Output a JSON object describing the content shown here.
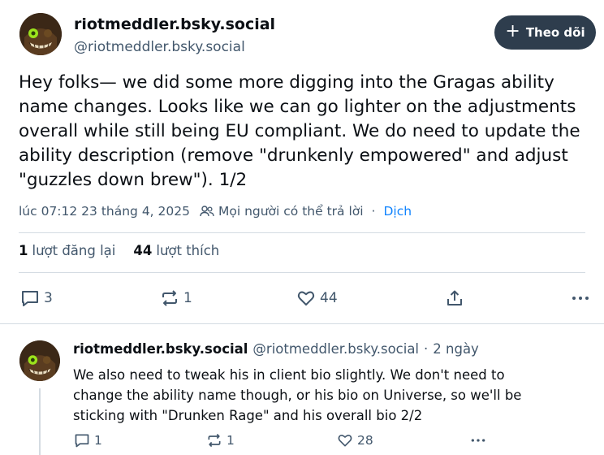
{
  "main_post": {
    "display_name": "riotmeddler.bsky.social",
    "handle": "@riotmeddler.bsky.social",
    "follow_label": "Theo dõi",
    "text": "Hey folks— we did some more digging into the Gragas ability\nname changes. Looks like we can go lighter on the adjustments\noverall while still being EU compliant. We do need to update the\nability description (remove \"drunkenly empowered\" and adjust\n\"guzzles down brew\"). 1/2",
    "timestamp": "lúc 07:12 23 tháng 4, 2025",
    "reply_setting": "Mọi người có thể trả lời",
    "separator": "·",
    "translate_label": "Dịch",
    "reposts_count": "1",
    "reposts_label": "lượt đăng lại",
    "likes_count": "44",
    "likes_label": "lượt thích",
    "actions": {
      "replies": "3",
      "reposts": "1",
      "likes": "44"
    }
  },
  "reply_post": {
    "display_name": "riotmeddler.bsky.social",
    "handle": "@riotmeddler.bsky.social",
    "separator": "·",
    "time": "2 ngày",
    "text": " We also need to tweak his in client bio slightly. We don't need to\nchange the ability name though, or his bio on Universe, so we'll be\nsticking with \"Drunken Rage\" and his overall bio 2/2",
    "actions": {
      "replies": "1",
      "reposts": "1",
      "likes": "28"
    }
  },
  "icons": {
    "follow": "plus-icon",
    "reply_setting": "people-icon",
    "reply": "speech-bubble-icon",
    "repost": "repost-icon",
    "like": "heart-icon",
    "share": "share-icon",
    "more": "more-dots-icon"
  },
  "colors": {
    "follow_button": "#2e3d4d",
    "secondary_text": "#42576c",
    "link": "#1083fe",
    "divider": "#d4dbe2"
  }
}
